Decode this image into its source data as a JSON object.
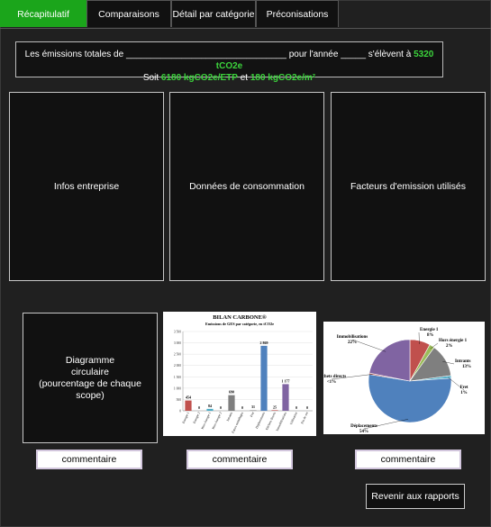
{
  "tabs": [
    {
      "label": "Récapitulatif",
      "active": true
    },
    {
      "label": "Comparaisons"
    },
    {
      "label": "Détail par catégorie"
    },
    {
      "label": "Préconisations"
    }
  ],
  "summary": {
    "line1_prefix": "Les émissions totales de ________________________________ pour l'année _____ s'élèvent à ",
    "total": "5320 tCO2e",
    "line2_prefix": "Soit ",
    "per_etp": "6180 kgCO2e/ETP",
    "and": " et ",
    "per_m2": "180 kgCO2e/m²"
  },
  "panels": {
    "infos": "Infos entreprise",
    "consommation": "Données de consommation",
    "facteurs": "Facteurs d'emission utilisés"
  },
  "diagramme": "Diagramme\ncirculaire\n(pourcentage de chaque scope)",
  "comment_label": "commentaire",
  "back_button": "Revenir aux rapports",
  "colors": {
    "accent": "#1ba51b",
    "highlight": "#3cd43c"
  },
  "chart_data": [
    {
      "type": "bar",
      "title": "BILAN CARBONE®",
      "subtitle": "Emissions de GES par catégorie, en tCO2e",
      "categories": [
        "Energie 1",
        "Energie 2",
        "Hors énergie 1",
        "Hors énergie 2",
        "Intrants",
        "Futurs emballages",
        "Fret",
        "Déplacements",
        "Déchets directs",
        "Immobilisations",
        "Utilisation",
        "Fin de vie"
      ],
      "values": [
        454,
        0,
        84,
        0,
        690,
        0,
        31,
        2869,
        25,
        1177,
        0,
        0
      ],
      "value_labels": [
        "454",
        "0",
        "84",
        "0",
        "690",
        "0",
        "31",
        "2 869",
        "25",
        "1 177",
        "0",
        "0"
      ],
      "bar_colors": [
        "#c0504d",
        "#9bbb59",
        "#4bacc6",
        "#f79646",
        "#7f7f7f",
        "#8064a2",
        "#a6a6a6",
        "#4f81bd",
        "#c0504d",
        "#8064a2",
        "#9bbb59",
        "#4bacc6"
      ],
      "yticks": [
        "0",
        "500",
        "1 000",
        "1 500",
        "2 000",
        "2 500",
        "3 000",
        "3 500"
      ],
      "ylim": [
        0,
        3500
      ]
    },
    {
      "type": "pie",
      "slices": [
        {
          "label": "Energie 1",
          "pct": 8,
          "text": "8%",
          "color": "#c0504d"
        },
        {
          "label": "Hors énergie 1",
          "pct": 2,
          "text": "2%",
          "color": "#9bbb59"
        },
        {
          "label": "Intrants",
          "pct": 13,
          "text": "13%",
          "color": "#7f7f7f"
        },
        {
          "label": "Fret",
          "pct": 1,
          "text": "1%",
          "color": "#4bacc6"
        },
        {
          "label": "Déplacements",
          "pct": 54,
          "text": "54%",
          "color": "#4f81bd"
        },
        {
          "label": "Déchets directs",
          "pct": 0.5,
          "text": "<1%",
          "color": "#c0504d"
        },
        {
          "label": "Immobilisations",
          "pct": 22,
          "text": "22%",
          "color": "#8064a2"
        }
      ]
    }
  ]
}
